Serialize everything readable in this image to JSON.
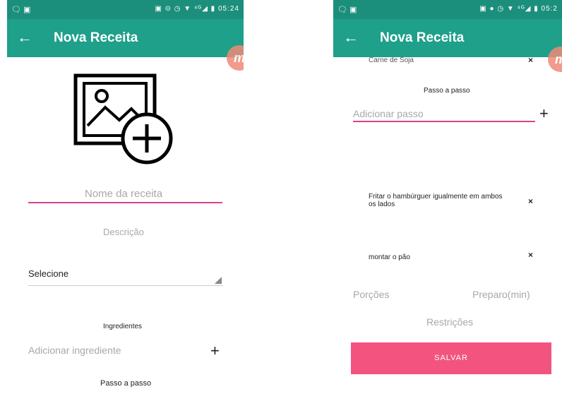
{
  "left": {
    "status": {
      "left": "🗨 ▣",
      "right": "▣ ⊝ ◷ ▼ ⁴ᴳ◢ ▮ 05:24"
    },
    "appbar": {
      "back": "←",
      "title": "Nova Receita"
    },
    "badge": "m",
    "form": {
      "recipe_name_placeholder": "Nome da receita",
      "description_placeholder": "Descrição",
      "select_value": "Selecione",
      "ingredients_header": "Ingredientes",
      "add_ingredient_placeholder": "Adicionar ingrediente",
      "add_icon": "+",
      "steps_header": "Passo a passo"
    }
  },
  "right": {
    "status": {
      "left": "🗨 ▣",
      "right": "▣ ● ◷ ▼ ⁴ᴳ◢ ▮ 05:2"
    },
    "appbar": {
      "back": "←",
      "title": "Nova Receita"
    },
    "badge": "m",
    "ingredient_item": "Carne de Soja",
    "steps_header": "Passo a passo",
    "add_step_placeholder": "Adicionar passo",
    "add_icon": "+",
    "steps": [
      {
        "text": "Fritar o hambúrguer igualmente em ambos os lados",
        "remove": "×"
      },
      {
        "text": "montar o pão",
        "remove": "×"
      }
    ],
    "ingredient_remove": "×",
    "portions_placeholder": "Porções",
    "prep_placeholder": "Preparo(min)",
    "restrictions_placeholder": "Restrições",
    "save_label": "SALVAR",
    "colors": {
      "appbar": "#1ea08a",
      "statusbar": "#1b8f7c",
      "accent": "#d7428c",
      "save_button": "#f2547f"
    }
  }
}
